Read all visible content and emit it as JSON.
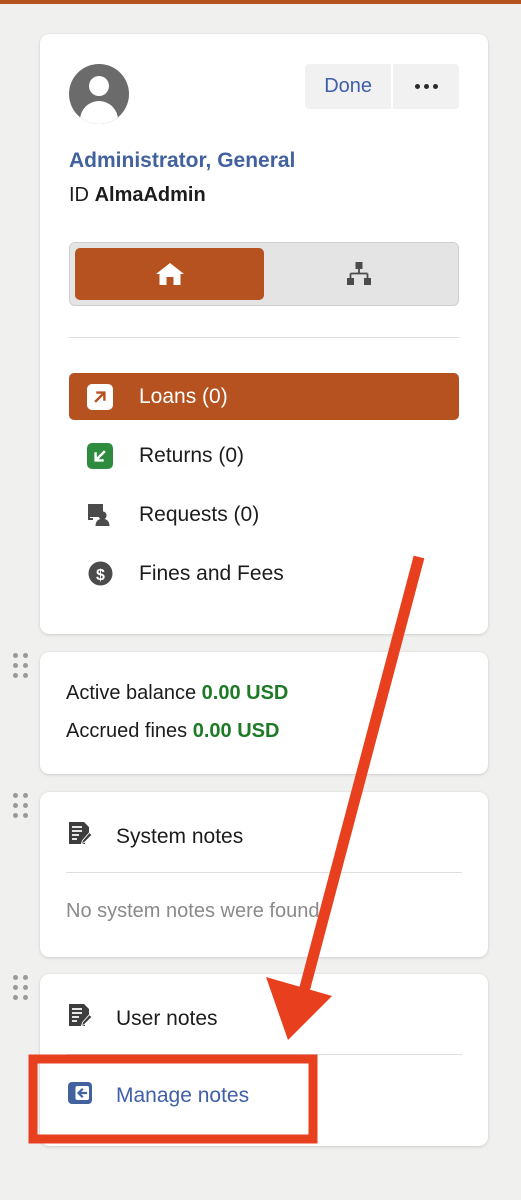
{
  "theme": {
    "accent_orange": "#b5521f",
    "link_blue": "#3f5fa8",
    "name_blue": "#41619f",
    "money_green": "#1e7a26",
    "annotation_red": "#e8401f",
    "page_bg": "#f0f0ef",
    "card_bg": "#ffffff"
  },
  "profile": {
    "avatar_icon": "user-avatar-icon",
    "done_label": "Done",
    "more_icon": "ellipsis-icon",
    "name": "Administrator, General",
    "id_label": "ID",
    "id_value": "AlmaAdmin",
    "tabs": [
      {
        "icon": "home-icon",
        "active": true
      },
      {
        "icon": "sitemap-icon",
        "active": false
      }
    ],
    "menu": [
      {
        "label": "Loans  (0)",
        "icon": "loans-arrow-out-icon",
        "active": true
      },
      {
        "label": "Returns  (0)",
        "icon": "returns-arrow-in-icon",
        "active": false
      },
      {
        "label": "Requests  (0)",
        "icon": "requests-screen-person-icon",
        "active": false
      },
      {
        "label": "Fines and Fees",
        "icon": "dollar-circle-icon",
        "active": false
      }
    ]
  },
  "balance": {
    "active_label": "Active balance",
    "active_value": "0.00 USD",
    "accrued_label": "Accrued fines",
    "accrued_value": "0.00 USD"
  },
  "system_notes": {
    "icon": "note-pencil-icon",
    "title": "System notes",
    "empty_text": "No system notes were found"
  },
  "user_notes": {
    "icon": "note-pencil-icon",
    "title": "User notes",
    "manage_icon": "manage-notes-icon",
    "manage_label": "Manage notes"
  },
  "drag_handle_icon": "drag-handle-icon"
}
